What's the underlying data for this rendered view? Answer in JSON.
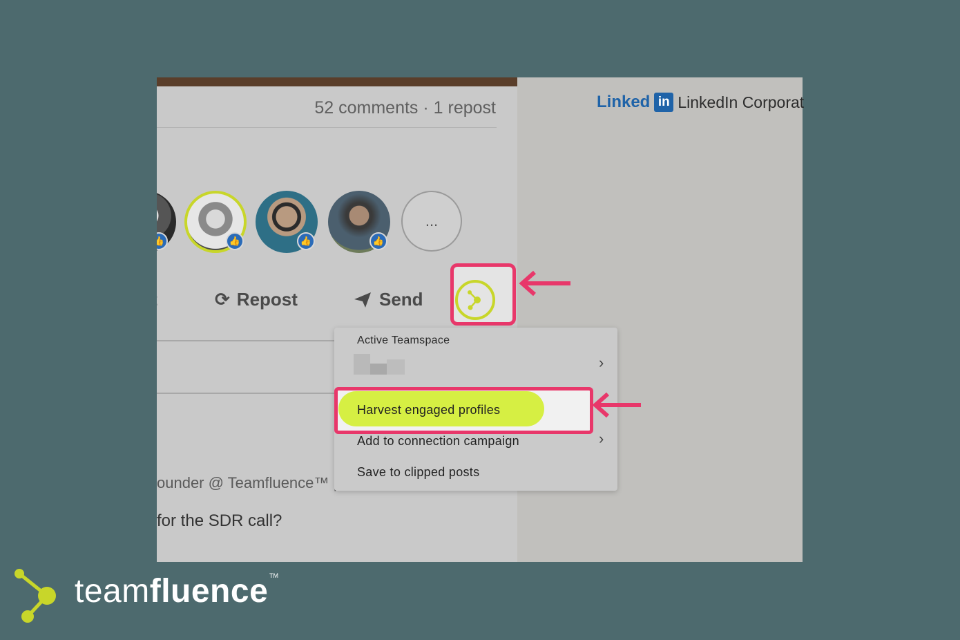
{
  "post": {
    "counts": "52 comments · 1 repost",
    "more_label": "...",
    "actions": {
      "repost": "Repost",
      "send": "Send",
      "left_partial": "t"
    },
    "founder_text": "ounder @ Teamfluence™",
    "founder_trail": "|",
    "comment_text": "for the SDR call?"
  },
  "menu": {
    "section_label": "Active Teamspace",
    "items": [
      "Harvest engaged profiles",
      "Add to connection campaign",
      "Save to clipped posts"
    ]
  },
  "linkedin": {
    "logo_word": "Linked",
    "logo_in": "in",
    "corp_text": "LinkedIn Corporat"
  },
  "brand": {
    "light": "team",
    "bold": "fluence",
    "tm": "TM"
  },
  "colors": {
    "background": "#4d6a6e",
    "highlight": "#e8376a",
    "accent": "#d6ef43",
    "linkedin_blue": "#1f63a8"
  }
}
